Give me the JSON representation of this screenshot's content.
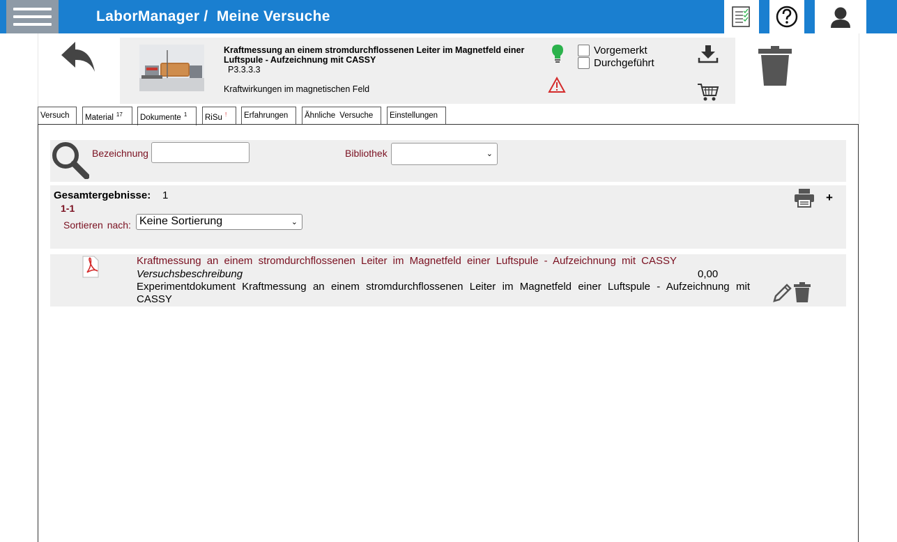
{
  "header": {
    "app_title": "LaborManager /  Meine Versuche"
  },
  "experiment": {
    "title": "Kraftmessung an einem stromdurchflossenen Leiter im Magnetfeld einer Luftspule - Aufzeichnung mit CASSY",
    "code": "P3.3.3.3",
    "topic": "Kraftwirkungen im magnetischen Feld",
    "status_options": [
      "Vorgemerkt",
      "Durchgeführt"
    ]
  },
  "tabs": [
    {
      "label": "Versuch",
      "badge": ""
    },
    {
      "label": "Material",
      "badge": "17"
    },
    {
      "label": "Dokumente",
      "badge": "1"
    },
    {
      "label": "RiSu",
      "badge": "!"
    },
    {
      "label": "Erfahrungen",
      "badge": ""
    },
    {
      "label": "Ähnliche Versuche",
      "badge": ""
    },
    {
      "label": "Einstellungen",
      "badge": ""
    }
  ],
  "search": {
    "bezeichnung_label": "Bezeichnung",
    "bezeichnung_value": "",
    "bibliothek_label": "Bibliothek",
    "bibliothek_value": ""
  },
  "results": {
    "total_label": "Gesamtergebnisse:",
    "total_value": "1",
    "range": "1-1",
    "sort_label": "Sortieren  nach:",
    "sort_value": "Keine Sortierung",
    "plus_label": "+"
  },
  "documents": [
    {
      "title": "Kraftmessung an einem stromdurchflossenen Leiter im Magnetfeld einer Luftspule - Aufzeichnung mit CASSY",
      "type": "Versuchsbeschreibung",
      "price": "0,00",
      "description": "Experimentdokument Kraftmessung an einem stromdurchflossenen Leiter im Magnetfeld einer Luftspule - Aufzeichnung mit CASSY"
    }
  ],
  "colors": {
    "header_blue": "#1a7fd0",
    "menu_gray": "#8e9aa6",
    "accent_red": "#7a1020",
    "panel_gray": "#efefef",
    "bulb_green": "#2bb24c",
    "warning_red": "#d42a2a"
  },
  "icons": [
    "menu-icon",
    "checklist-icon",
    "help-icon",
    "user-icon",
    "back-arrow-icon",
    "lightbulb-icon",
    "warning-icon",
    "download-icon",
    "cart-icon",
    "trash-icon",
    "search-icon",
    "printer-icon",
    "pdf-icon",
    "edit-icon"
  ]
}
